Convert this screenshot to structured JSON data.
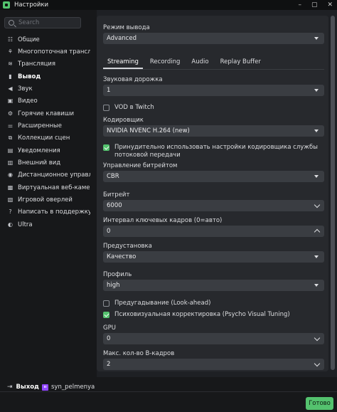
{
  "window": {
    "title": "Настройки",
    "controls": [
      "–",
      "▢",
      "✕"
    ]
  },
  "sidebar": {
    "search_placeholder": "Search",
    "items": [
      {
        "label": "Общие",
        "icon": "sliders-icon",
        "glyph": "☷"
      },
      {
        "label": "Многопоточная трансляц",
        "icon": "multistream-icon",
        "glyph": "⚘"
      },
      {
        "label": "Трансляция",
        "icon": "broadcast-icon",
        "glyph": "≋"
      },
      {
        "label": "Вывод",
        "icon": "output-icon",
        "glyph": "▮"
      },
      {
        "label": "Звук",
        "icon": "speaker-icon",
        "glyph": "◀"
      },
      {
        "label": "Видео",
        "icon": "video-icon",
        "glyph": "▣"
      },
      {
        "label": "Горячие клавиши",
        "icon": "gear-icon",
        "glyph": "⚙"
      },
      {
        "label": "Расширенные",
        "icon": "advanced-icon",
        "glyph": "⚌"
      },
      {
        "label": "Коллекции сцен",
        "icon": "collections-icon",
        "glyph": "⧉"
      },
      {
        "label": "Уведомления",
        "icon": "notification-icon",
        "glyph": "▤"
      },
      {
        "label": "Внешний вид",
        "icon": "appearance-icon",
        "glyph": "▥"
      },
      {
        "label": "Дистанционное управлен",
        "icon": "remote-icon",
        "glyph": "◉"
      },
      {
        "label": "Виртуальная веб-камера",
        "icon": "webcam-icon",
        "glyph": "▩"
      },
      {
        "label": "Игровой оверлей",
        "icon": "overlay-icon",
        "glyph": "▧"
      },
      {
        "label": "Написать в поддержку",
        "icon": "support-icon",
        "glyph": "?"
      },
      {
        "label": "Ultra",
        "icon": "ultra-icon",
        "glyph": "◐"
      }
    ],
    "active_index": 3
  },
  "output": {
    "mode_label": "Режим вывода",
    "mode_value": "Advanced",
    "tabs": [
      "Streaming",
      "Recording",
      "Audio",
      "Replay Buffer"
    ],
    "active_tab": "Streaming",
    "audio_track_label": "Звуковая дорожка",
    "audio_track_value": "1",
    "vod_twitch_label": "VOD в Twitch",
    "vod_twitch_checked": false,
    "encoder_label": "Кодировщик",
    "encoder_value": "NVIDIA NVENC H.264 (new)",
    "enforce_label": "Принудительно использовать настройки кодировщика службы потоковой передачи",
    "enforce_checked": true,
    "rate_control_label": "Управление битрейтом",
    "rate_control_value": "CBR",
    "bitrate_label": "Битрейт",
    "bitrate_value": "6000",
    "keyframe_label": "Интервал ключевых кадров (0=авто)",
    "keyframe_value": "0",
    "preset_label": "Предустановка",
    "preset_value": "Качество",
    "profile_label": "Профиль",
    "profile_value": "high",
    "lookahead_label": "Предугадывание (Look-ahead)",
    "lookahead_checked": false,
    "psycho_label": "Психовизуальная корректировка (Psycho Visual Tuning)",
    "psycho_checked": true,
    "gpu_label": "GPU",
    "gpu_value": "0",
    "bframes_label": "Макс. кол-во B-кадров",
    "bframes_value": "2"
  },
  "footer": {
    "logout_label": "Выход",
    "username": "syn_pelmenya",
    "done_label": "Готово"
  },
  "colors": {
    "accent": "#54c26e",
    "twitch": "#9146ff"
  }
}
